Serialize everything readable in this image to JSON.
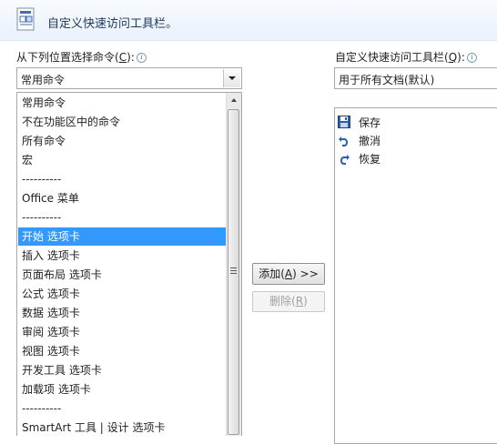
{
  "header": {
    "title": "自定义快速访问工具栏。"
  },
  "left": {
    "label": "从下列位置选择命令(C):",
    "label_prefix": "从下列位置选择命令(",
    "label_key": "C",
    "label_suffix": "):",
    "combo_value": "常用命令",
    "items": [
      {
        "label": "常用命令"
      },
      {
        "label": "不在功能区中的命令"
      },
      {
        "label": "所有命令"
      },
      {
        "label": "宏"
      },
      {
        "label": "----------"
      },
      {
        "label": "Office 菜单"
      },
      {
        "label": "----------"
      },
      {
        "label": "开始 选项卡",
        "selected": true
      },
      {
        "label": "插入 选项卡"
      },
      {
        "label": "页面布局 选项卡"
      },
      {
        "label": "公式 选项卡"
      },
      {
        "label": "数据 选项卡"
      },
      {
        "label": "审阅 选项卡"
      },
      {
        "label": "视图 选项卡"
      },
      {
        "label": "开发工具 选项卡"
      },
      {
        "label": "加载项 选项卡"
      },
      {
        "label": "----------"
      },
      {
        "label": "SmartArt 工具 | 设计 选项卡"
      }
    ]
  },
  "middle": {
    "add_prefix": "添加(",
    "add_key": "A",
    "add_suffix": ") >>",
    "remove_prefix": "删除(",
    "remove_key": "R",
    "remove_suffix": ")"
  },
  "right": {
    "label_prefix": "自定义快速访问工具栏(",
    "label_key": "Q",
    "label_suffix": "):",
    "combo_value": "用于所有文档(默认)",
    "items": [
      {
        "label": "保存",
        "icon": "save-icon"
      },
      {
        "label": "撤消",
        "icon": "undo-icon"
      },
      {
        "label": "恢复",
        "icon": "redo-icon"
      }
    ]
  },
  "colors": {
    "selection": "#3399ff",
    "header_text": "#1e395b"
  }
}
